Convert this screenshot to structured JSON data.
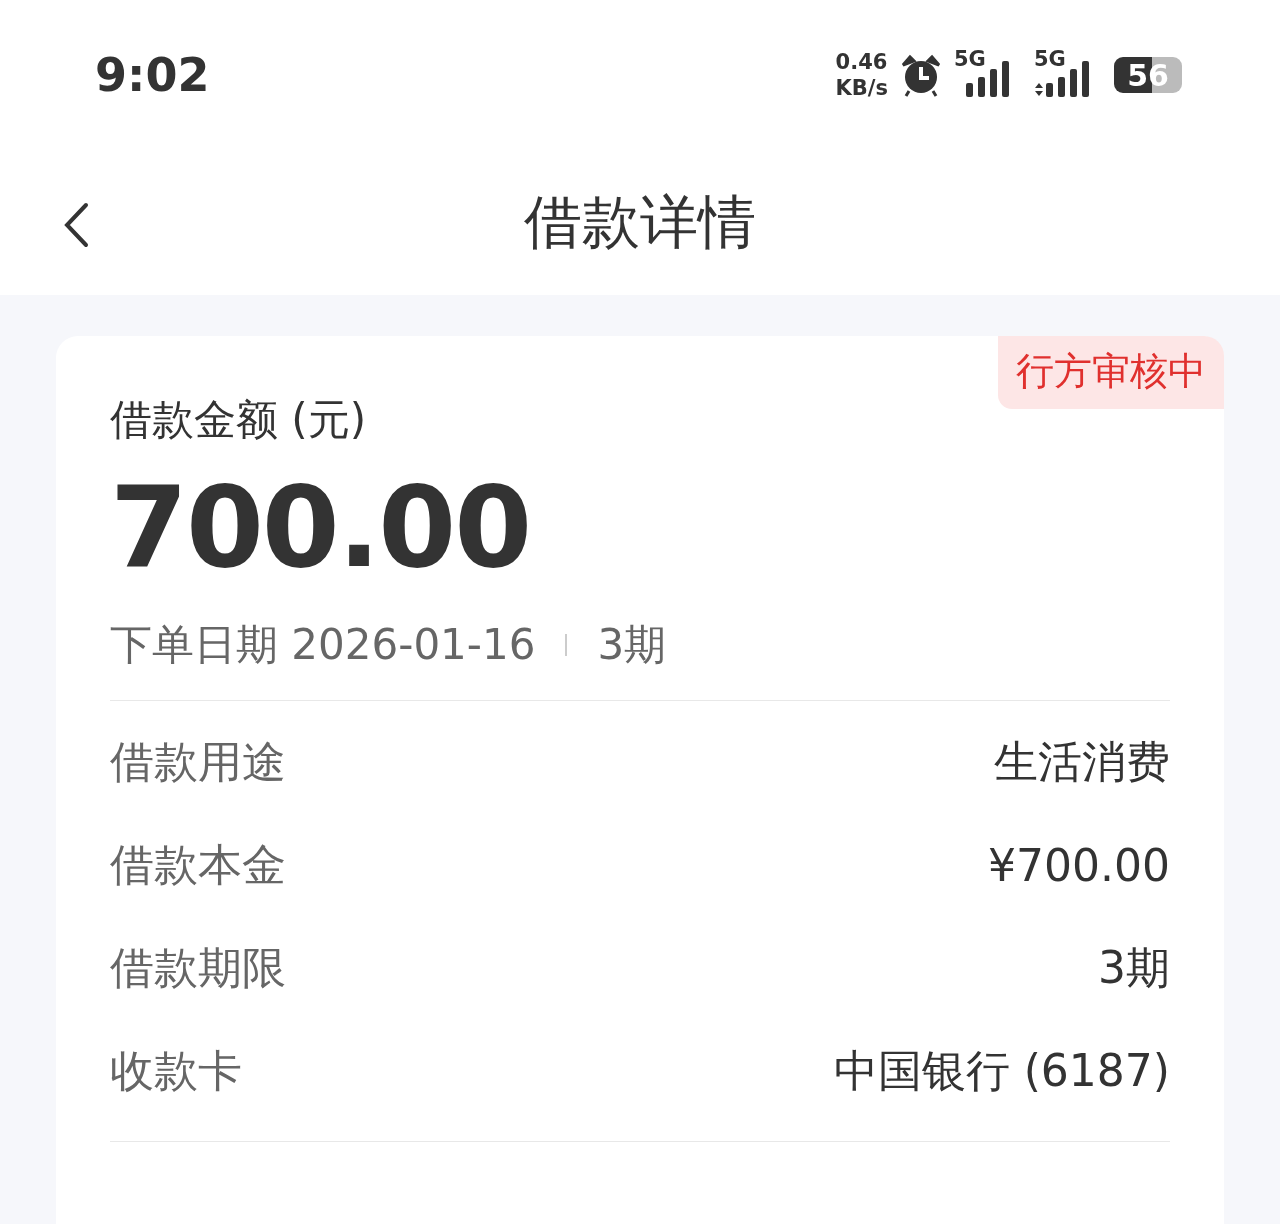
{
  "status_bar": {
    "time": "9:02",
    "net_speed": [
      "0.46",
      "KB/s"
    ],
    "networks": [
      {
        "label": "5G",
        "kind": "plain"
      },
      {
        "label": "5G",
        "kind": "data"
      }
    ],
    "battery": "56"
  },
  "header": {
    "title": "借款详情"
  },
  "card": {
    "badge": "行方审核中",
    "amount_label": "借款金额 (元)",
    "amount": "700.00",
    "order_date": "下单日期 2026-01-16",
    "term": "3期",
    "rows": [
      {
        "label": "借款用途",
        "value": "生活消费"
      },
      {
        "label": "借款本金",
        "value": "¥700.00"
      },
      {
        "label": "借款期限",
        "value": "3期"
      },
      {
        "label": "收款卡",
        "value": "中国银行 (6187)"
      }
    ]
  }
}
